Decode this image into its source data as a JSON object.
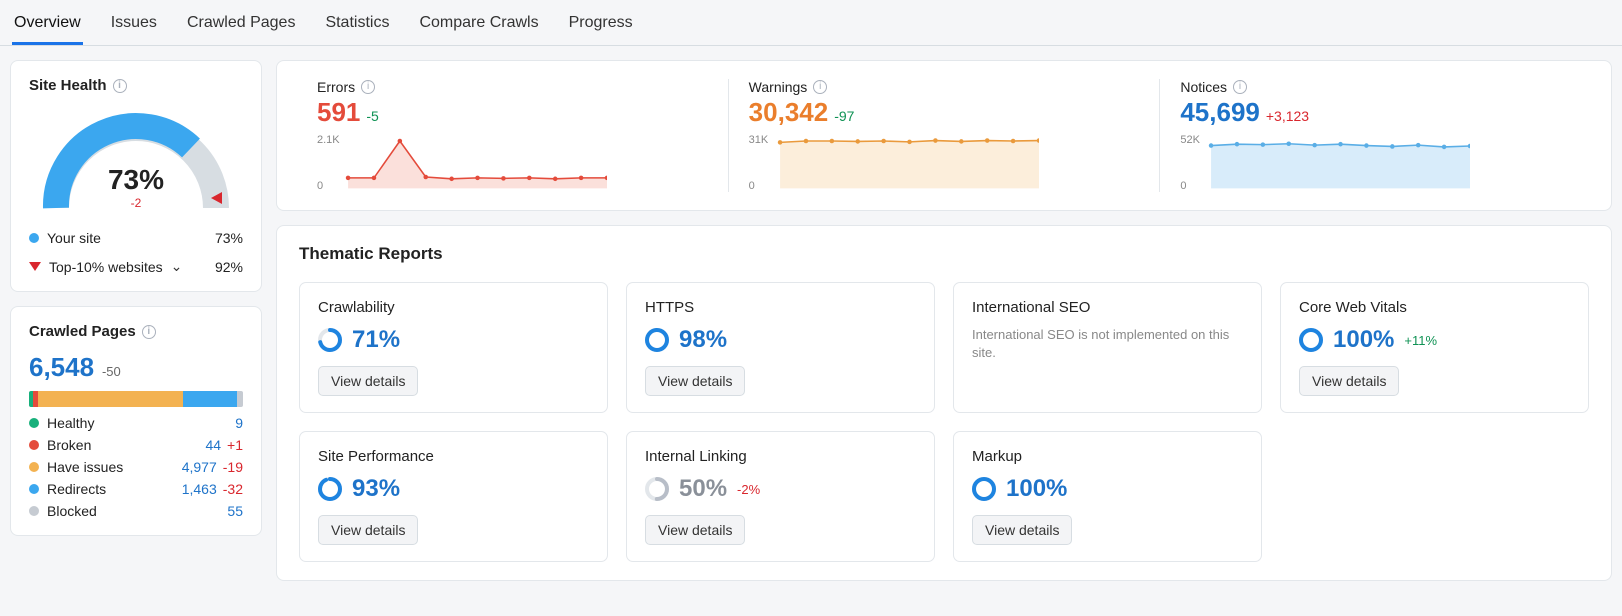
{
  "tabs": [
    "Overview",
    "Issues",
    "Crawled Pages",
    "Statistics",
    "Compare Crawls",
    "Progress"
  ],
  "active_tab": 0,
  "health": {
    "title": "Site Health",
    "pct": "73%",
    "delta": "-2",
    "your_site_label": "Your site",
    "your_site_val": "73%",
    "top_label": "Top-10% websites",
    "top_val": "92%"
  },
  "crawled": {
    "title": "Crawled Pages",
    "total": "6,548",
    "delta": "-50",
    "bar": [
      {
        "color": "#18b07b",
        "w": 2
      },
      {
        "color": "#e44b3b",
        "w": 2
      },
      {
        "color": "#f3b251",
        "w": 68
      },
      {
        "color": "#3ba7ef",
        "w": 25
      },
      {
        "color": "#c6cbd2",
        "w": 3
      }
    ],
    "rows": [
      {
        "dot": "#18b07b",
        "label": "Healthy",
        "val": "9",
        "delta": "",
        "dclass": ""
      },
      {
        "dot": "#e44b3b",
        "label": "Broken",
        "val": "44",
        "delta": "+1",
        "dclass": "dneg"
      },
      {
        "dot": "#f3b251",
        "label": "Have issues",
        "val": "4,977",
        "delta": "-19",
        "dclass": "dneg"
      },
      {
        "dot": "#3ba7ef",
        "label": "Redirects",
        "val": "1,463",
        "delta": "-32",
        "dclass": "dneg"
      },
      {
        "dot": "#c6cbd2",
        "label": "Blocked",
        "val": "55",
        "delta": "",
        "dclass": ""
      }
    ]
  },
  "top": [
    {
      "label": "Errors",
      "val": "591",
      "delta": "-5",
      "dclass": "c-err dpos",
      "vclass": "c-err",
      "ytick": "2.1K",
      "stroke": "#e44b3b",
      "fill": "#fbe0db",
      "pts": [
        0.86,
        0.86,
        0.05,
        0.84,
        0.88,
        0.86,
        0.87,
        0.86,
        0.88,
        0.86,
        0.86
      ]
    },
    {
      "label": "Warnings",
      "val": "30,342",
      "delta": "-97",
      "dclass": "c-warn dpos",
      "vclass": "c-warn",
      "ytick": "31K",
      "stroke": "#ea9a3c",
      "fill": "#fceedb",
      "pts": [
        0.08,
        0.05,
        0.05,
        0.06,
        0.05,
        0.07,
        0.04,
        0.06,
        0.04,
        0.05,
        0.04
      ]
    },
    {
      "label": "Notices",
      "val": "45,699",
      "delta": "+3,123",
      "dclass": "c-not dneg",
      "vclass": "c-not",
      "ytick": "52K",
      "stroke": "#5aaee6",
      "fill": "#d8ecfa",
      "pts": [
        0.15,
        0.12,
        0.13,
        0.11,
        0.14,
        0.12,
        0.15,
        0.17,
        0.14,
        0.18,
        0.16
      ]
    }
  ],
  "reports": {
    "title": "Thematic Reports",
    "btn": "View details",
    "cards": [
      {
        "title": "Crawlability",
        "pct": "71%",
        "delta": "",
        "ring": 71,
        "gray": false
      },
      {
        "title": "HTTPS",
        "pct": "98%",
        "delta": "",
        "ring": 98,
        "gray": false
      },
      {
        "title": "International SEO",
        "note": "International SEO is not implemented on this site."
      },
      {
        "title": "Core Web Vitals",
        "pct": "100%",
        "delta": "+11%",
        "dclass": "dpos",
        "ring": 100,
        "gray": false
      },
      {
        "title": "Site Performance",
        "pct": "93%",
        "delta": "",
        "ring": 93,
        "gray": false
      },
      {
        "title": "Internal Linking",
        "pct": "50%",
        "delta": "-2%",
        "dclass": "dneg",
        "ring": 50,
        "gray": true
      },
      {
        "title": "Markup",
        "pct": "100%",
        "delta": "",
        "ring": 100,
        "gray": false
      }
    ]
  },
  "chart_data": [
    {
      "type": "line",
      "title": "Errors",
      "ylabel": "",
      "ylim": [
        0,
        2100
      ],
      "x": [
        1,
        2,
        3,
        4,
        5,
        6,
        7,
        8,
        9,
        10,
        11
      ],
      "values": [
        294,
        294,
        1995,
        336,
        252,
        294,
        273,
        294,
        252,
        294,
        294
      ]
    },
    {
      "type": "line",
      "title": "Warnings",
      "ylabel": "",
      "ylim": [
        0,
        31000
      ],
      "x": [
        1,
        2,
        3,
        4,
        5,
        6,
        7,
        8,
        9,
        10,
        11
      ],
      "values": [
        28520,
        29450,
        29450,
        29140,
        29450,
        28830,
        29760,
        29140,
        29760,
        29450,
        29760
      ]
    },
    {
      "type": "line",
      "title": "Notices",
      "ylabel": "",
      "ylim": [
        0,
        52000
      ],
      "x": [
        1,
        2,
        3,
        4,
        5,
        6,
        7,
        8,
        9,
        10,
        11
      ],
      "values": [
        44200,
        45760,
        45240,
        46280,
        44720,
        45760,
        44200,
        43160,
        44720,
        42640,
        43680
      ]
    }
  ]
}
